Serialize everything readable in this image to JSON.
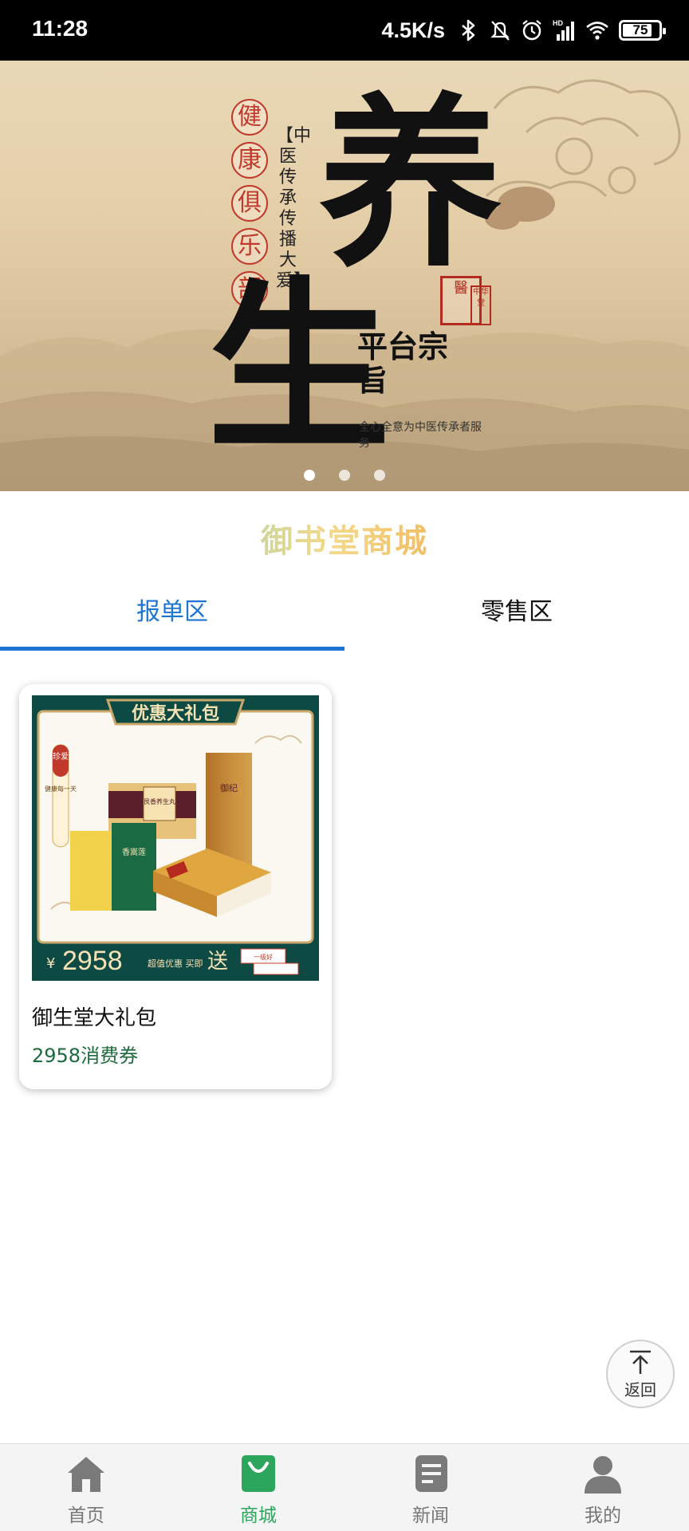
{
  "status_bar": {
    "time": "11:28",
    "net_speed": "4.5K/s",
    "battery": "75",
    "icons": [
      "bluetooth-icon",
      "mute-icon",
      "alarm-icon",
      "hd-signal-icon",
      "wifi-icon",
      "battery-icon"
    ]
  },
  "banner": {
    "club_chars": [
      "健",
      "康",
      "俱",
      "乐",
      "部"
    ],
    "vertical_text": "【中医传承 传播大爱】",
    "big_char_1": "养",
    "big_char_2": "生",
    "purpose_title": "平台宗旨",
    "purpose_sub": "全心全意为中医传承者服务",
    "seal_text": "醫",
    "seal_small": "中华堂",
    "slide_count": 3,
    "active_slide": 1
  },
  "shop_title": "御书堂商城",
  "tabs": [
    {
      "label": "报单区",
      "active": true
    },
    {
      "label": "零售区",
      "active": false
    }
  ],
  "products": [
    {
      "name": "御生堂大礼包",
      "price": "2958消费券",
      "image": {
        "banner_label": "优惠大礼包",
        "side_tag": "珍爱",
        "side_text": "健康每一天",
        "box_label_1": "艮香养生丸",
        "box_label_2": "御纪",
        "box_label_3": "香嵩莲",
        "price_currency": "¥",
        "price_value": "2958",
        "promo_text": "超值优惠 买即",
        "gift_text": "送",
        "gift_box_text": "一级好"
      }
    }
  ],
  "back_to_top": {
    "label": "返回"
  },
  "bottom_nav": [
    {
      "label": "首页",
      "icon": "home-icon",
      "active": false
    },
    {
      "label": "商城",
      "icon": "shopping-bag-icon",
      "active": true
    },
    {
      "label": "新闻",
      "icon": "news-icon",
      "active": false
    },
    {
      "label": "我的",
      "icon": "user-icon",
      "active": false
    }
  ],
  "colors": {
    "tab_active": "#1c75d2",
    "nav_active": "#2ca55d",
    "price_green": "#1d6a3c",
    "product_bg": "#0e4a44",
    "seal_red": "#b52a1e"
  }
}
